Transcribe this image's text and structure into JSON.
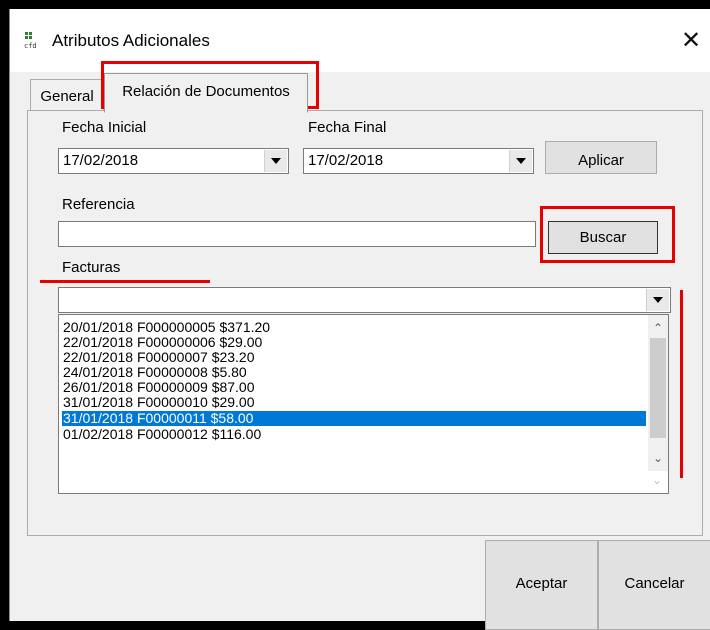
{
  "window": {
    "title": "Atributos Adicionales",
    "close_symbol": "✕"
  },
  "tabs": [
    {
      "label": "General",
      "active": false
    },
    {
      "label": "Relación de Documentos",
      "active": true
    }
  ],
  "form": {
    "fecha_inicial_label": "Fecha Inicial",
    "fecha_inicial_value": "17/02/2018",
    "fecha_final_label": "Fecha Final",
    "fecha_final_value": "17/02/2018",
    "aplicar_label": "Aplicar",
    "referencia_label": "Referencia",
    "referencia_value": "",
    "buscar_label": "Buscar",
    "facturas_label": "Facturas",
    "facturas_combo_value": ""
  },
  "facturas_list": {
    "items": [
      "20/01/2018 F000000005 $371.20",
      "22/01/2018 F000000006 $29.00",
      "22/01/2018 F00000007 $23.20",
      "24/01/2018 F00000008 $5.80",
      "26/01/2018 F00000009 $87.00",
      "31/01/2018 F00000010 $29.00",
      "31/01/2018 F00000011 $58.00",
      "01/02/2018 F00000012 $116.00"
    ],
    "selected_index": 6
  },
  "footer": {
    "aceptar_label": "Aceptar",
    "cancelar_label": "Cancelar"
  },
  "colors": {
    "selection": "#0078d7",
    "annotation_red": "#e60000"
  }
}
